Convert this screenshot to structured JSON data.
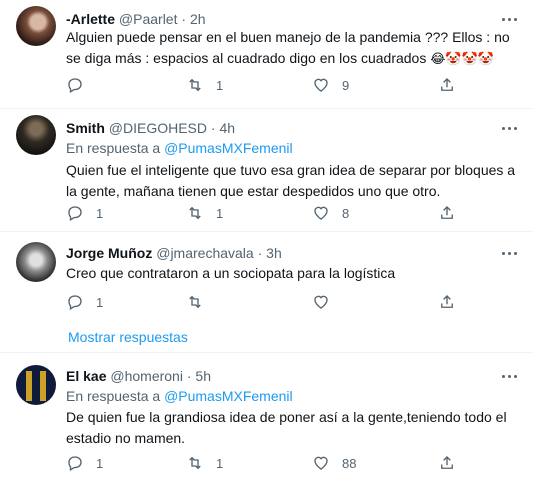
{
  "tweets": [
    {
      "name": "-Arlette",
      "handle": "@Paarlet",
      "dot": "·",
      "time": "2h",
      "reply_label": "",
      "reply_mention": "",
      "text": "Alguien puede pensar en el buen manejo de la pandemia ??? Ellos : no se diga más : espacios al cuadrado digo en los cuadrados",
      "emojis": "😂🤡🤡🤡",
      "replies": "",
      "retweets": "1",
      "likes": "9"
    },
    {
      "name": "Smith",
      "handle": "@DIEGOHESD",
      "dot": "·",
      "time": "4h",
      "reply_label": "En respuesta a",
      "reply_mention": "@PumasMXFemenil",
      "text": "Quien fue el inteligente que tuvo esa gran idea de separar por bloques a la gente, mañana tienen que estar despedidos uno que otro.",
      "emojis": "",
      "replies": "1",
      "retweets": "1",
      "likes": "8"
    },
    {
      "name": "Jorge Muñoz",
      "handle": "@jmarechavala",
      "dot": "·",
      "time": "3h",
      "reply_label": "",
      "reply_mention": "",
      "text": "Creo que contrataron a un sociopata para la logística",
      "emojis": "",
      "replies": "1",
      "retweets": "",
      "likes": ""
    },
    {
      "name": "El kae",
      "handle": "@homeroni",
      "dot": "·",
      "time": "5h",
      "reply_label": "En respuesta a",
      "reply_mention": "@PumasMXFemenil",
      "text": "De quien fue la grandiosa idea de poner así a la gente,teniendo todo el estadio no mamen.",
      "emojis": "",
      "replies": "1",
      "retweets": "1",
      "likes": "88"
    }
  ],
  "show_more_label": "Mostrar respuestas",
  "icons": [
    "reply-icon",
    "retweet-icon",
    "like-icon",
    "share-icon",
    "more-icon"
  ],
  "colors": {
    "accent": "#1d9bf0",
    "secondary_text": "#536471",
    "divider": "#eff3f4"
  }
}
